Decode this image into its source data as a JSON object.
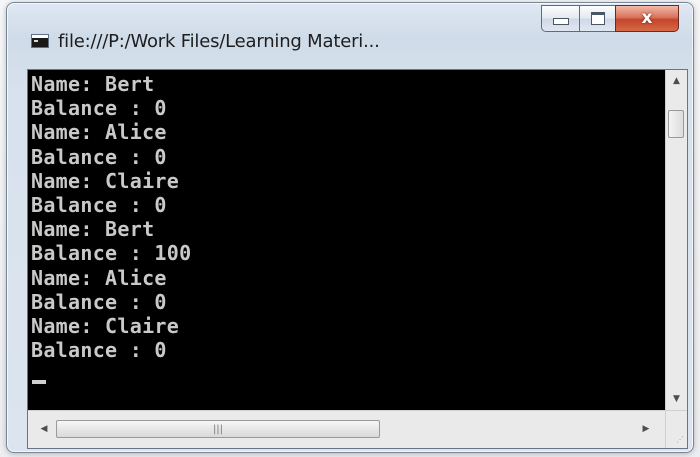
{
  "window": {
    "title": "file:///P:/Work Files/Learning Materi...",
    "controls": {
      "minimize": "minimize",
      "maximize": "maximize",
      "close": "x"
    }
  },
  "console": {
    "lines": [
      "Name: Bert",
      "Balance : 0",
      "Name: Alice",
      "Balance : 0",
      "Name: Claire",
      "Balance : 0",
      "Name: Bert",
      "Balance : 100",
      "Name: Alice",
      "Balance : 0",
      "Name: Claire",
      "Balance : 0"
    ],
    "text_color": "#c9c9c9",
    "background": "#000000"
  },
  "icons": {
    "app": "console-icon",
    "scroll_up": "up-arrow-icon",
    "scroll_down": "down-arrow-icon",
    "scroll_left": "left-arrow-icon",
    "scroll_right": "right-arrow-icon",
    "grip": "grip-icon"
  },
  "colors": {
    "close_button": "#c4452b",
    "titlebar": "#d8e2ee"
  }
}
